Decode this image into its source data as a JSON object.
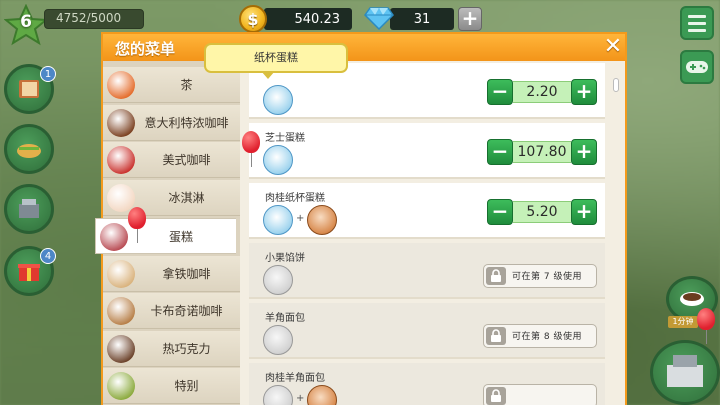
{
  "hud": {
    "level": "6",
    "xp": "4752/5000",
    "coins": "540.23",
    "coin_symbol": "$",
    "gems": "31",
    "add": "+",
    "badge_1": "1",
    "badge_2": "4",
    "register_tag": "1分钟"
  },
  "dialog": {
    "title": "您的菜单",
    "close": "✕",
    "tooltip": "纸杯蛋糕"
  },
  "categories": [
    {
      "label": "茶",
      "icon": "tea-cup-icon",
      "color": "#e46b2a"
    },
    {
      "label": "意大利特浓咖啡",
      "icon": "espresso-cup-icon",
      "color": "#7a3f1f"
    },
    {
      "label": "美式咖啡",
      "icon": "american-coffee-icon",
      "color": "#c9302c"
    },
    {
      "label": "冰淇淋",
      "icon": "ice-cream-icon",
      "color": "#f3d7c2"
    },
    {
      "label": "蛋糕",
      "icon": "cake-icon",
      "color": "#b84a52"
    },
    {
      "label": "拿铁咖啡",
      "icon": "latte-icon",
      "color": "#d9b27c"
    },
    {
      "label": "卡布奇诺咖啡",
      "icon": "cappuccino-icon",
      "color": "#b67d45"
    },
    {
      "label": "热巧克力",
      "icon": "hot-chocolate-icon",
      "color": "#6a4028"
    },
    {
      "label": "特别",
      "icon": "special-icon",
      "color": "#8aa93b"
    }
  ],
  "active_category": 4,
  "items": [
    {
      "name": "",
      "price": "2.20",
      "icons": [
        "cupcake-icon"
      ],
      "locked": false
    },
    {
      "name": "芝士蛋糕",
      "price": "107.80",
      "icons": [
        "cheesecake-icon"
      ],
      "locked": false
    },
    {
      "name": "肉桂纸杯蛋糕",
      "price": "5.20",
      "icons": [
        "cupcake-icon",
        "cinnamon-icon"
      ],
      "locked": false
    },
    {
      "name": "小果馅饼",
      "lock_text": "可在第 7 级使用",
      "icons": [
        "tart-icon"
      ],
      "locked": true
    },
    {
      "name": "羊角面包",
      "lock_text": "可在第 8 级使用",
      "icons": [
        "croissant-icon"
      ],
      "locked": true
    },
    {
      "name": "肉桂羊角面包",
      "lock_text": "",
      "icons": [
        "croissant-icon",
        "cinnamon-icon"
      ],
      "locked": true
    }
  ],
  "controls": {
    "minus": "−",
    "plus": "+"
  }
}
